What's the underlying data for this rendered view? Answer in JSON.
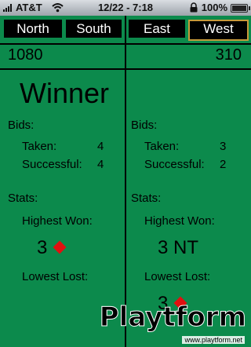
{
  "status_bar": {
    "carrier": "AT&T",
    "time": "12/22 - 7:18",
    "battery": "100%"
  },
  "teams": [
    {
      "label": "North",
      "selected": false
    },
    {
      "label": "South",
      "selected": false
    },
    {
      "label": "East",
      "selected": false
    },
    {
      "label": "West",
      "selected": true
    }
  ],
  "left": {
    "score": "1080",
    "result": "Winner",
    "bids_label": "Bids:",
    "taken_label": "Taken:",
    "taken_value": "4",
    "successful_label": "Successful:",
    "successful_value": "4",
    "stats_label": "Stats:",
    "highest_won_label": "Highest Won:",
    "highest_won_value": "3",
    "highest_won_suit": "diamond",
    "lowest_lost_label": "Lowest Lost:"
  },
  "right": {
    "score": "310",
    "bids_label": "Bids:",
    "taken_label": "Taken:",
    "taken_value": "3",
    "successful_label": "Successful:",
    "successful_value": "2",
    "stats_label": "Stats:",
    "highest_won_label": "Highest Won:",
    "highest_won_value": "3 NT",
    "lowest_lost_label": "Lowest Lost:",
    "lowest_lost_value": "3",
    "lowest_lost_suit": "diamond"
  },
  "watermark": {
    "brand": "Playtform",
    "url": "www.playtform.net"
  },
  "colors": {
    "felt": "#0c8a4c",
    "selected_border": "#c69a3a",
    "diamond": "#e01010"
  }
}
